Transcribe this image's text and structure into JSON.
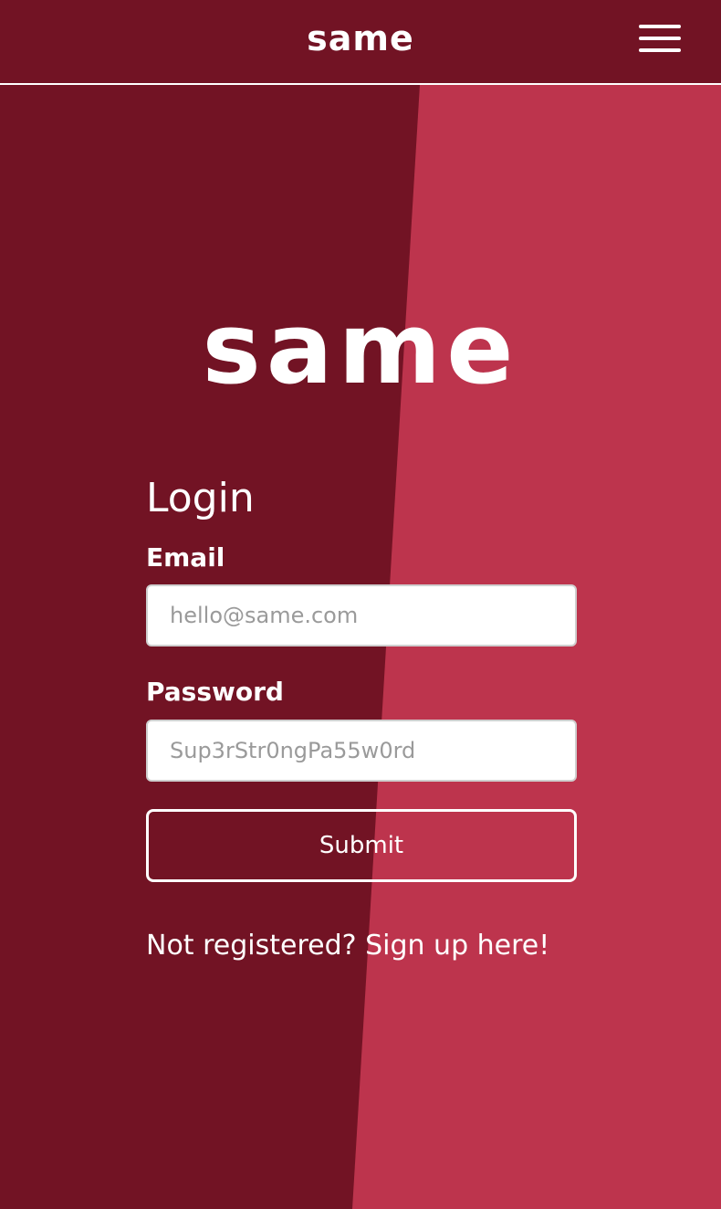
{
  "header": {
    "brand": "same",
    "menu_icon": "hamburger-menu-icon"
  },
  "hero": {
    "brand": "same"
  },
  "login": {
    "title": "Login",
    "email_label": "Email",
    "email_placeholder": "hello@same.com",
    "email_value": "",
    "password_label": "Password",
    "password_placeholder": "Sup3rStr0ngPa55w0rd",
    "password_value": "",
    "submit_label": "Submit",
    "signup_text": "Not registered? Sign up here!"
  },
  "colors": {
    "dark_red": "#721324",
    "light_red": "#bd344d",
    "white": "#ffffff"
  }
}
